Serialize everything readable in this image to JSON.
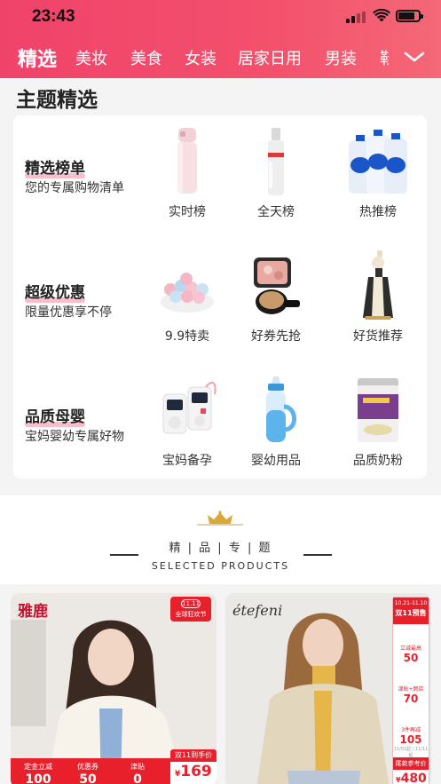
{
  "status_bar": {
    "time": "23:43"
  },
  "nav": {
    "tabs": [
      "精选",
      "美妆",
      "美食",
      "女装",
      "居家日用",
      "男装",
      "鞋"
    ],
    "active_index": 0
  },
  "theme": {
    "title": "主题精选",
    "rows": [
      {
        "title": "精选榜单",
        "subtitle": "您的专属购物清单",
        "items": [
          "实时榜",
          "全天榜",
          "热推榜"
        ]
      },
      {
        "title": "超级优惠",
        "subtitle": "限量优惠享不停",
        "items": [
          "9.9特卖",
          "好券先抢",
          "好货推荐"
        ]
      },
      {
        "title": "品质母婴",
        "subtitle": "宝妈婴幼专属好物",
        "items": [
          "宝妈备孕",
          "婴幼用品",
          "品质奶粉"
        ]
      }
    ]
  },
  "selected": {
    "title_zh": "精 | 品 | 专 | 题",
    "title_en": "SELECTED PRODUCTS"
  },
  "products": [
    {
      "brand": "雅鹿",
      "badge_top": "11.11",
      "badge_bottom": "全球狂欢节",
      "promo": [
        {
          "label": "定金立减",
          "value": "100"
        },
        {
          "label": "优惠券",
          "value": "50"
        },
        {
          "label": "津贴",
          "value": "0"
        }
      ],
      "price_label": "双11到手价",
      "currency": "¥",
      "price": "169"
    },
    {
      "brand": "étefeni",
      "side_date": "10.21-11.10",
      "side_title": "双11预售",
      "side_items": [
        {
          "label": "立减最高",
          "value": "50"
        },
        {
          "label": "津贴+跨店",
          "value": "70"
        },
        {
          "label": "3件再减",
          "value": "105"
        }
      ],
      "side_note": "11/01起 / 11/11起",
      "price_label": "尾款参考价",
      "currency": "¥",
      "price": "480"
    }
  ],
  "colors": {
    "brand_pink": "#f0436a",
    "promo_red": "#e8202c"
  }
}
